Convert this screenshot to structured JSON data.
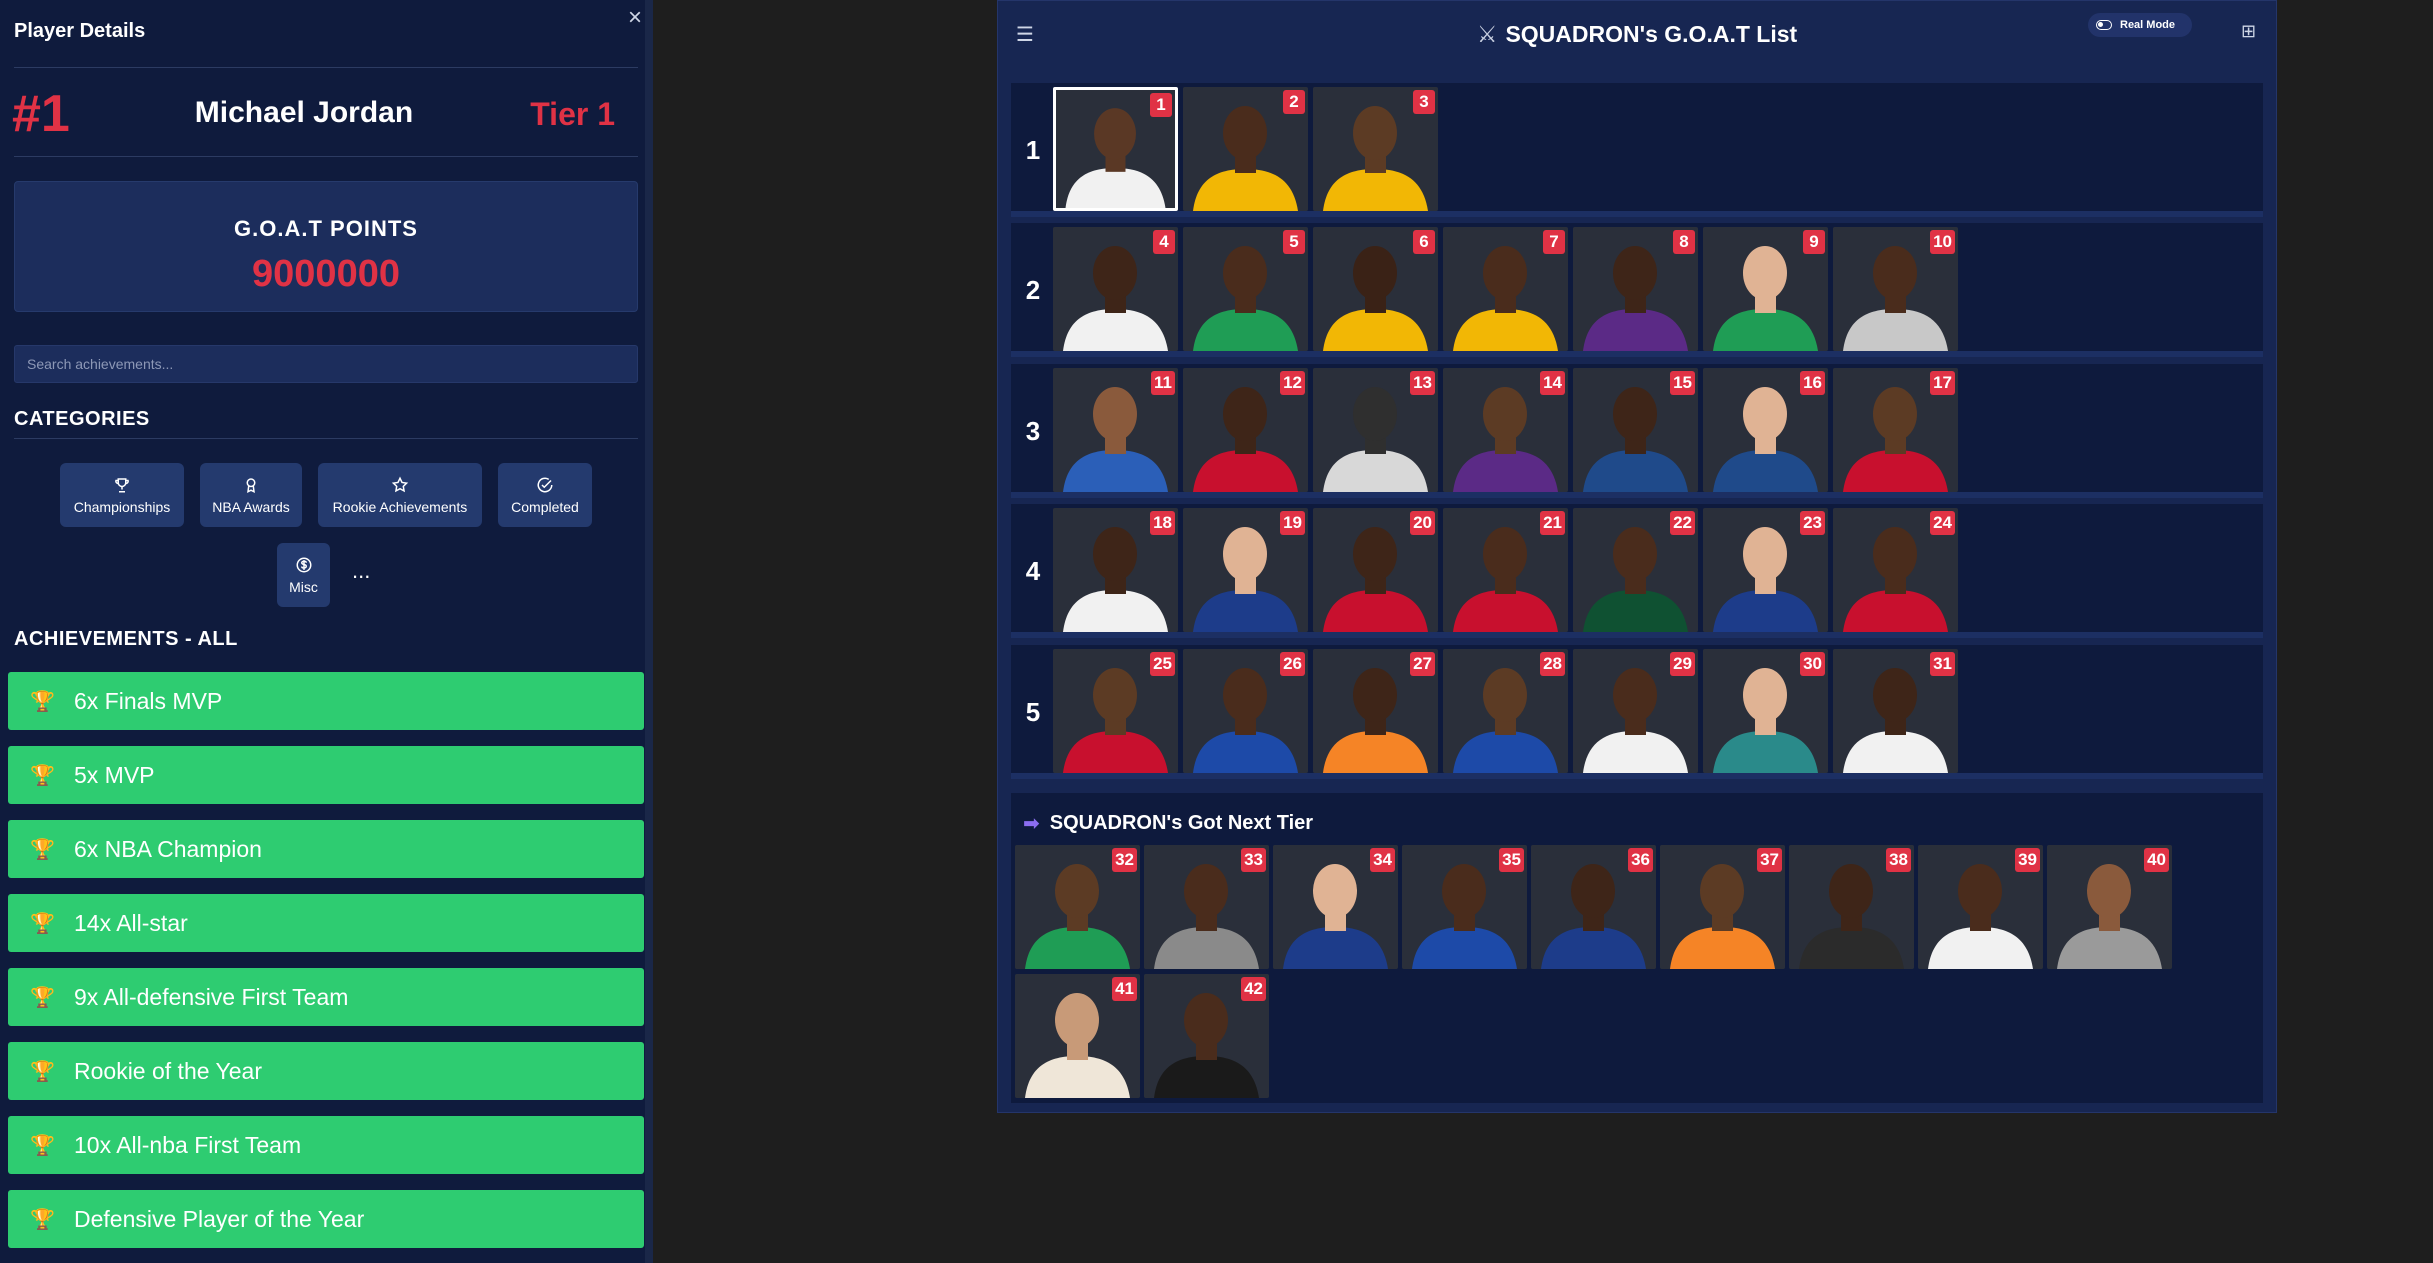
{
  "sidebar": {
    "title": "Player Details",
    "close_label": "×",
    "rank": "#1",
    "player_name": "Michael Jordan",
    "tier": "Tier 1",
    "points_label": "G.O.A.T POINTS",
    "points_value": "9000000",
    "search_placeholder": "Search achievements...",
    "categories_heading": "CATEGORIES",
    "categories": [
      {
        "label": "Championships",
        "icon": "trophy-icon"
      },
      {
        "label": "NBA Awards",
        "icon": "award-icon"
      },
      {
        "label": "Rookie Achievements",
        "icon": "star-icon"
      },
      {
        "label": "Completed",
        "icon": "check-circle-icon"
      },
      {
        "label": "Misc",
        "icon": "dollar-icon"
      }
    ],
    "more_label": "...",
    "achievements_heading": "ACHIEVEMENTS - ALL",
    "achievements": [
      "6x Finals MVP",
      "5x MVP",
      "6x NBA Champion",
      "14x All-star",
      "9x All-defensive First Team",
      "Rookie of the Year",
      "10x All-nba First Team",
      "Defensive Player of the Year"
    ],
    "achievement_color": "#2ecc71"
  },
  "board": {
    "menu_icon": "hamburger-menu-icon",
    "title": "SQUADRON's G.O.A.T List",
    "title_icon": "crossed-swords-icon",
    "real_mode_label": "Real Mode",
    "add_icon": "add-square-icon",
    "accent": "#e03245",
    "tiers": [
      {
        "label": "1",
        "players": [
          {
            "rank": "1",
            "jersey": "#f1f1f1",
            "skin": "#5a3825"
          },
          {
            "rank": "2",
            "jersey": "#f2b705",
            "skin": "#4a2c1c"
          },
          {
            "rank": "3",
            "jersey": "#f2b705",
            "skin": "#5c3b24"
          }
        ]
      },
      {
        "label": "2",
        "players": [
          {
            "rank": "4",
            "jersey": "#f1f1f1",
            "skin": "#3e2518"
          },
          {
            "rank": "5",
            "jersey": "#1f9d55",
            "skin": "#4a2c1c"
          },
          {
            "rank": "6",
            "jersey": "#f2b705",
            "skin": "#3a2216"
          },
          {
            "rank": "7",
            "jersey": "#f2b705",
            "skin": "#4a2c1c"
          },
          {
            "rank": "8",
            "jersey": "#5b2a86",
            "skin": "#3e2518"
          },
          {
            "rank": "9",
            "jersey": "#1f9d55",
            "skin": "#e0b394"
          },
          {
            "rank": "10",
            "jersey": "#c8c8c8",
            "skin": "#4a2c1c"
          }
        ]
      },
      {
        "label": "3",
        "players": [
          {
            "rank": "11",
            "jersey": "#2b5fb8",
            "skin": "#8a5a3c"
          },
          {
            "rank": "12",
            "jersey": "#c8102e",
            "skin": "#3e2518"
          },
          {
            "rank": "13",
            "jersey": "#d8d8d8",
            "skin": "#2f2f2f"
          },
          {
            "rank": "14",
            "jersey": "#5b2a86",
            "skin": "#5c3b24"
          },
          {
            "rank": "15",
            "jersey": "#1f4a8a",
            "skin": "#3e2518"
          },
          {
            "rank": "16",
            "jersey": "#1f4a8a",
            "skin": "#e0b394"
          },
          {
            "rank": "17",
            "jersey": "#c8102e",
            "skin": "#5c3b24"
          }
        ]
      },
      {
        "label": "4",
        "players": [
          {
            "rank": "18",
            "jersey": "#f1f1f1",
            "skin": "#3e2518"
          },
          {
            "rank": "19",
            "jersey": "#1d3c8a",
            "skin": "#e0b394"
          },
          {
            "rank": "20",
            "jersey": "#c8102e",
            "skin": "#3e2518"
          },
          {
            "rank": "21",
            "jersey": "#c8102e",
            "skin": "#4a2c1c"
          },
          {
            "rank": "22",
            "jersey": "#0f5132",
            "skin": "#4a2c1c"
          },
          {
            "rank": "23",
            "jersey": "#1d3c8a",
            "skin": "#e0b394"
          },
          {
            "rank": "24",
            "jersey": "#c8102e",
            "skin": "#4a2c1c"
          }
        ]
      },
      {
        "label": "5",
        "players": [
          {
            "rank": "25",
            "jersey": "#c8102e",
            "skin": "#5c3b24"
          },
          {
            "rank": "26",
            "jersey": "#1d4aa8",
            "skin": "#4a2c1c"
          },
          {
            "rank": "27",
            "jersey": "#f58426",
            "skin": "#3e2518"
          },
          {
            "rank": "28",
            "jersey": "#1d4aa8",
            "skin": "#5c3b24"
          },
          {
            "rank": "29",
            "jersey": "#f1f1f1",
            "skin": "#4a2c1c"
          },
          {
            "rank": "30",
            "jersey": "#2a8a8a",
            "skin": "#e0b394"
          },
          {
            "rank": "31",
            "jersey": "#f1f1f1",
            "skin": "#3e2518"
          }
        ]
      }
    ],
    "next_tier_title": "SQUADRON's Got Next Tier",
    "next_tier_icon": "arrow-right-icon",
    "next_tier": [
      {
        "rank": "32",
        "jersey": "#1f9d55",
        "skin": "#5c3b24"
      },
      {
        "rank": "33",
        "jersey": "#8a8a8a",
        "skin": "#4a2c1c"
      },
      {
        "rank": "34",
        "jersey": "#1d3c8a",
        "skin": "#e0b394"
      },
      {
        "rank": "35",
        "jersey": "#1d4aa8",
        "skin": "#4a2c1c"
      },
      {
        "rank": "36",
        "jersey": "#1d3c8a",
        "skin": "#3e2518"
      },
      {
        "rank": "37",
        "jersey": "#f58426",
        "skin": "#5c3b24"
      },
      {
        "rank": "38",
        "jersey": "#2b2b2b",
        "skin": "#3e2518"
      },
      {
        "rank": "39",
        "jersey": "#f1f1f1",
        "skin": "#4a2c1c"
      },
      {
        "rank": "40",
        "jersey": "#9a9a9a",
        "skin": "#8a5a3c"
      },
      {
        "rank": "41",
        "jersey": "#efe6d8",
        "skin": "#c89a78"
      },
      {
        "rank": "42",
        "jersey": "#1a1a1a",
        "skin": "#4a2c1c"
      }
    ]
  }
}
